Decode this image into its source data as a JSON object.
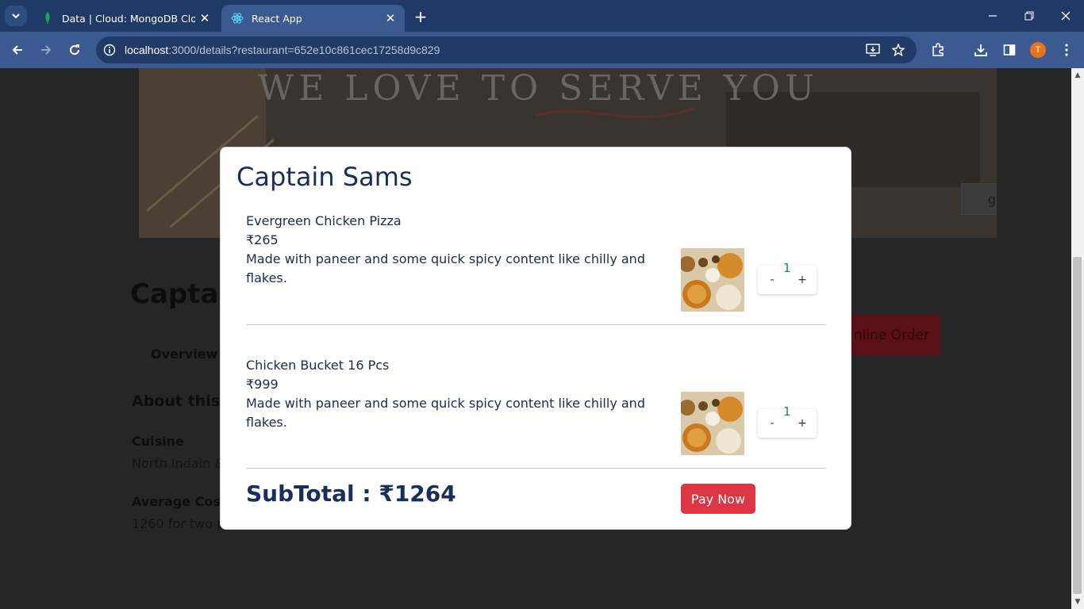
{
  "browser": {
    "tabs": [
      {
        "title": "Data | Cloud: MongoDB Cloud",
        "favicon": "mongodb-leaf-icon",
        "active": false
      },
      {
        "title": "React App",
        "favicon": "react-icon",
        "active": true
      }
    ],
    "url_host": "localhost",
    "url_path": ":3000/details?restaurant=652e10c861cec17258d9c829",
    "profile_initial": "T",
    "colors": {
      "tabbar": "#1f3a66",
      "toolbar": "#3b5a8f",
      "profile": "#e8731a"
    }
  },
  "background_page": {
    "hero_text": "WE LOVE TO SERVE YOU",
    "gallery_button": "ge Gallery",
    "restaurant_title": "Captai",
    "tab_overview": "Overview",
    "online_order_button": "nline Order",
    "about_heading": "About this",
    "cuisine_heading": "Cuisine",
    "cuisine_value": "North Indain &",
    "cost_heading": "Average Cost",
    "cost_value": "1260 for two p"
  },
  "modal": {
    "title": "Captain Sams",
    "items": [
      {
        "name": "Evergreen Chicken Pizza",
        "price": "₹265",
        "description": "Made with paneer and some quick spicy content like chilly and flakes.",
        "quantity": "1",
        "minus_label": "-",
        "plus_label": "+"
      },
      {
        "name": "Chicken Bucket 16 Pcs",
        "price": "₹999",
        "description": "Made with paneer and some quick spicy content like chilly and flakes.",
        "quantity": "1",
        "minus_label": "-",
        "plus_label": "+"
      }
    ],
    "subtotal": "SubTotal : ₹1264",
    "pay_button": "Pay Now",
    "colors": {
      "title": "#192f59",
      "pay_button": "#dc3545",
      "quantity": "#198754"
    }
  }
}
